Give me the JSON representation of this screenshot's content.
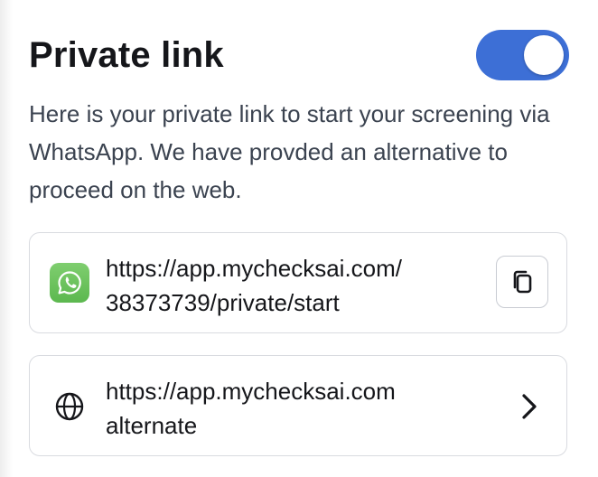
{
  "header": {
    "title": "Private link",
    "toggle_on": true,
    "toggle_color": "#3d6fd6"
  },
  "description": "Here is your private link to start your screening via WhatsApp. We have provded an alternative to proceed on the web.",
  "whatsapp_link": {
    "icon": "whatsapp-icon",
    "line1": "https://app.mychecksai.com/",
    "line2": "38373739/private/start",
    "action_icon": "copy-icon"
  },
  "web_link": {
    "icon": "globe-icon",
    "line1": "https://app.mychecksai.com",
    "line2": "alternate",
    "action_icon": "chevron-right-icon"
  }
}
